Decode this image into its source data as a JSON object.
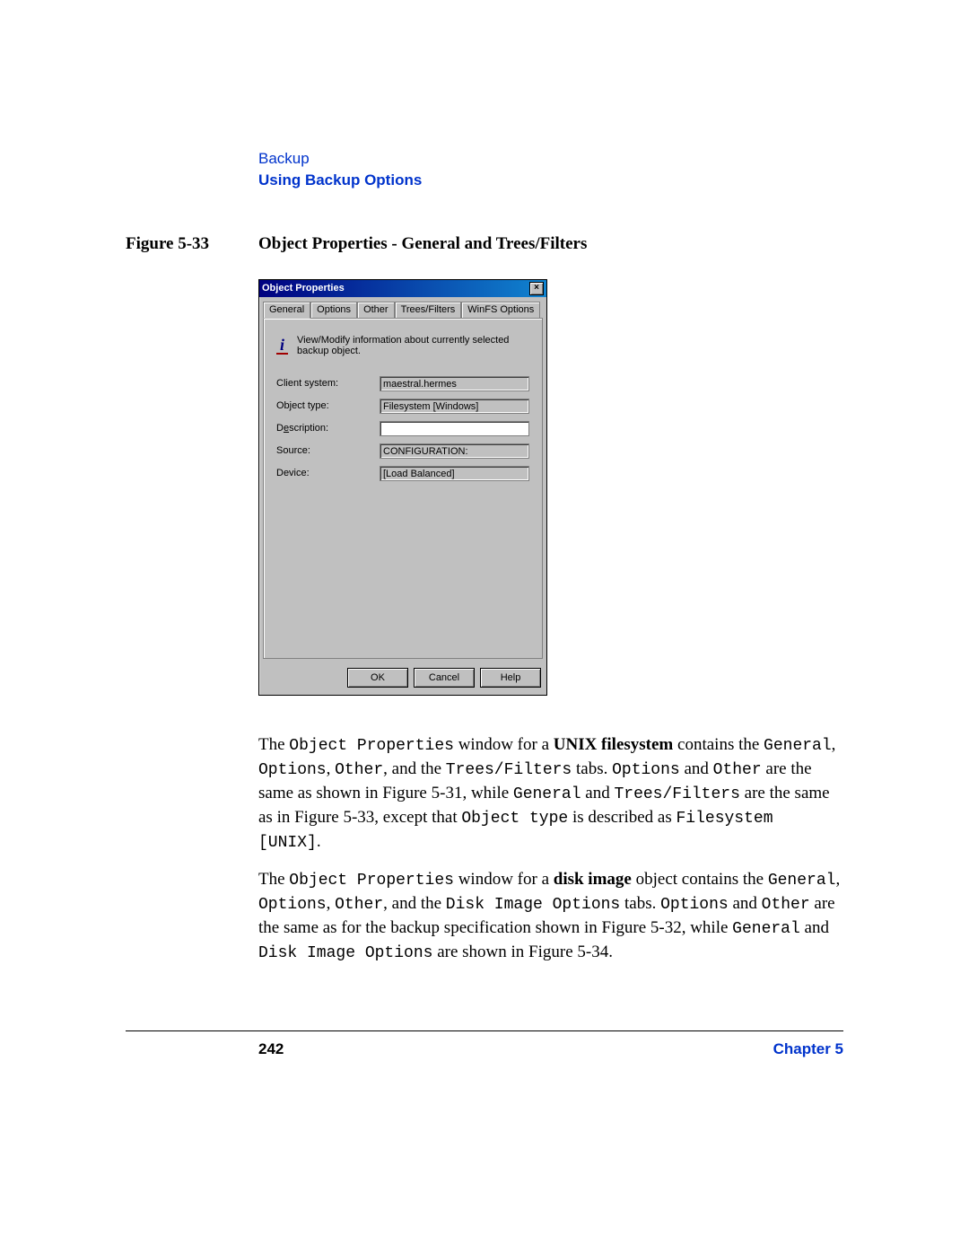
{
  "header": {
    "section": "Backup",
    "subsection": "Using Backup Options"
  },
  "figure": {
    "label": "Figure 5-33",
    "title": "Object Properties - General and Trees/Filters"
  },
  "dialog": {
    "title": "Object Properties",
    "close_glyph": "×",
    "tabs": [
      "General",
      "Options",
      "Other",
      "Trees/Filters",
      "WinFS Options"
    ],
    "info_text": "View/Modify information about currently selected backup object.",
    "fields": {
      "client_system": {
        "label": "Client system:",
        "value": "maestral.hermes"
      },
      "object_type": {
        "label": "Object type:",
        "value": "Filesystem [Windows]"
      },
      "description": {
        "label_pre": "D",
        "label_ul": "e",
        "label_post": "scription:",
        "value": ""
      },
      "source": {
        "label": "Source:",
        "value": "CONFIGURATION:"
      },
      "device": {
        "label": "Device:",
        "value": "[Load Balanced]"
      }
    },
    "buttons": {
      "ok": "OK",
      "cancel": "Cancel",
      "help": "Help"
    }
  },
  "paragraphs": {
    "p1": {
      "t1": "The ",
      "c1": "Object Properties",
      "t2": " window for a ",
      "b1": "UNIX filesystem",
      "t3": " contains the ",
      "c2": "General",
      "t4": ", ",
      "c3": "Options",
      "t5": ", ",
      "c4": "Other",
      "t6": ", and the ",
      "c5": "Trees/Filters",
      "t7": " tabs. ",
      "c6": "Options",
      "t8": " and ",
      "c7": "Other",
      "t9": " are the same as shown in Figure 5-31, while ",
      "c8": "General",
      "t10": " and ",
      "c9": "Trees/Filters",
      "t11": " are the same as in Figure 5-33, except that ",
      "c10": "Object type",
      "t12": " is described as ",
      "c11": "Filesystem [UNIX]",
      "t13": "."
    },
    "p2": {
      "t1": "The ",
      "c1": "Object Properties",
      "t2": " window for a ",
      "b1": "disk image",
      "t3": " object contains the ",
      "c2": "General",
      "t4": ", ",
      "c3": "Options",
      "t5": ", ",
      "c4": "Other",
      "t6": ", and the ",
      "c5": "Disk Image Options",
      "t7": " tabs. ",
      "c6": "Options",
      "t8": " and ",
      "c7": "Other",
      "t9": " are the same as for the backup specification shown in Figure 5-32, while ",
      "c8": "General",
      "t10": " and ",
      "c9": "Disk Image Options",
      "t11": " are shown in Figure 5-34."
    }
  },
  "footer": {
    "page": "242",
    "chapter": "Chapter 5"
  }
}
